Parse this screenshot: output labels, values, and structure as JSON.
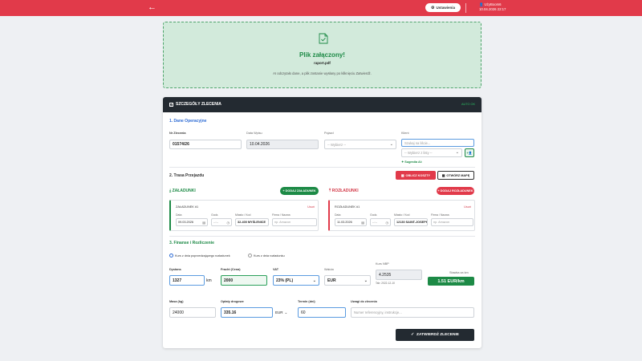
{
  "topbar": {
    "back_icon": "arrow-left-icon",
    "settings_label": "Ustawienia",
    "user_name": "UżyBoom6",
    "datetime": "10.04.2026 22:17"
  },
  "upload": {
    "title": "Plik załączony!",
    "file_name": "raport.pdf",
    "hint": "AI odczytało dane, a plik zostanie wysłany po kliknięciu Zatwierdź."
  },
  "card": {
    "title": "SZCZEGÓŁY ZLECENIA",
    "status": "AUTO OK"
  },
  "ops": {
    "section": "1. Dane Operacyjne",
    "order_no_label": "Nr Zlecenia",
    "order_no": "01574/26",
    "issue_date_label": "Data Wpisu",
    "issue_date": "10.04.2026",
    "vehicle_label": "Pojazd",
    "vehicle_value": "-- Wybierz --",
    "client_label": "Klient",
    "client_search_placeholder": "Szukaj na liście...",
    "client_select_value": "-- Wybierz z listy --",
    "client_suggestion": "Sugestia AI:"
  },
  "route": {
    "section": "2. Trasa Przejazdu",
    "calc_costs": "OBLICZ KOSZTY",
    "open_map": "OTWÓRZ MAPĘ",
    "loading_title": "ZAŁADUNKI",
    "add_loading": "+ DODAJ ZAŁADUNEK",
    "unloading_title": "ROZŁADUNKI",
    "add_unloading": "+ DODAJ ROZŁADUNEK",
    "loading": {
      "name": "ZAŁADUNEK #1",
      "remove": "Usuń",
      "date_label": "Data",
      "date": "09.03.2026",
      "time_label": "Godz.",
      "time": "--:--",
      "place_label": "Miasto / Kod",
      "place": "32-400 MYŚLENICE",
      "company_label": "Firma / Nazwa",
      "company_placeholder": "np. Amazon"
    },
    "unloading": {
      "name": "ROZŁADUNEK #1",
      "remove": "Usuń",
      "date_label": "Data",
      "date": "11.03.2026",
      "time_label": "Godz.",
      "time": "--:--",
      "place_label": "Miasto / Kod",
      "place": "12130 SAINT-JOSEPH",
      "company_label": "Firma / Nazwa",
      "company_placeholder": "np. Amazon"
    }
  },
  "finance": {
    "section": "3. Finanse i Rozliczenie",
    "radio_prev": "Kurs z dnia poprzedzającego rozładunek",
    "radio_same": "Kurs z dnia rozładunku",
    "distance_label": "Dystans",
    "distance": "1327",
    "distance_unit": "km",
    "freight_label": "Fracht (Cena)",
    "freight": "2000",
    "vat_label": "VAT",
    "vat": "23% (PL)",
    "currency_label": "Waluta",
    "currency": "EUR",
    "rate_label": "Kurs NBP",
    "rate": "4.2535",
    "rate_table": "Tab: 2022-12-10",
    "per_km_label": "Stawka za km",
    "per_km": "1.51 EUR/km",
    "weight_label": "Masa (kg)",
    "weight": "24000",
    "road_fees_label": "Opłaty drogowe",
    "road_fees": "335.16",
    "road_fees_currency": "EUR",
    "term_label": "Termin (dni)",
    "term": "60",
    "notes_label": "Uwagi do zlecenia",
    "notes_placeholder": "Numer referencyjny, instrukcje..."
  },
  "submit_label": "ZATWIERDŹ ZLECENIE",
  "colors": {
    "brand_red": "#e13a4a",
    "success_green": "#1d8a46",
    "dark": "#232a31",
    "link_blue": "#2d6bd4"
  }
}
